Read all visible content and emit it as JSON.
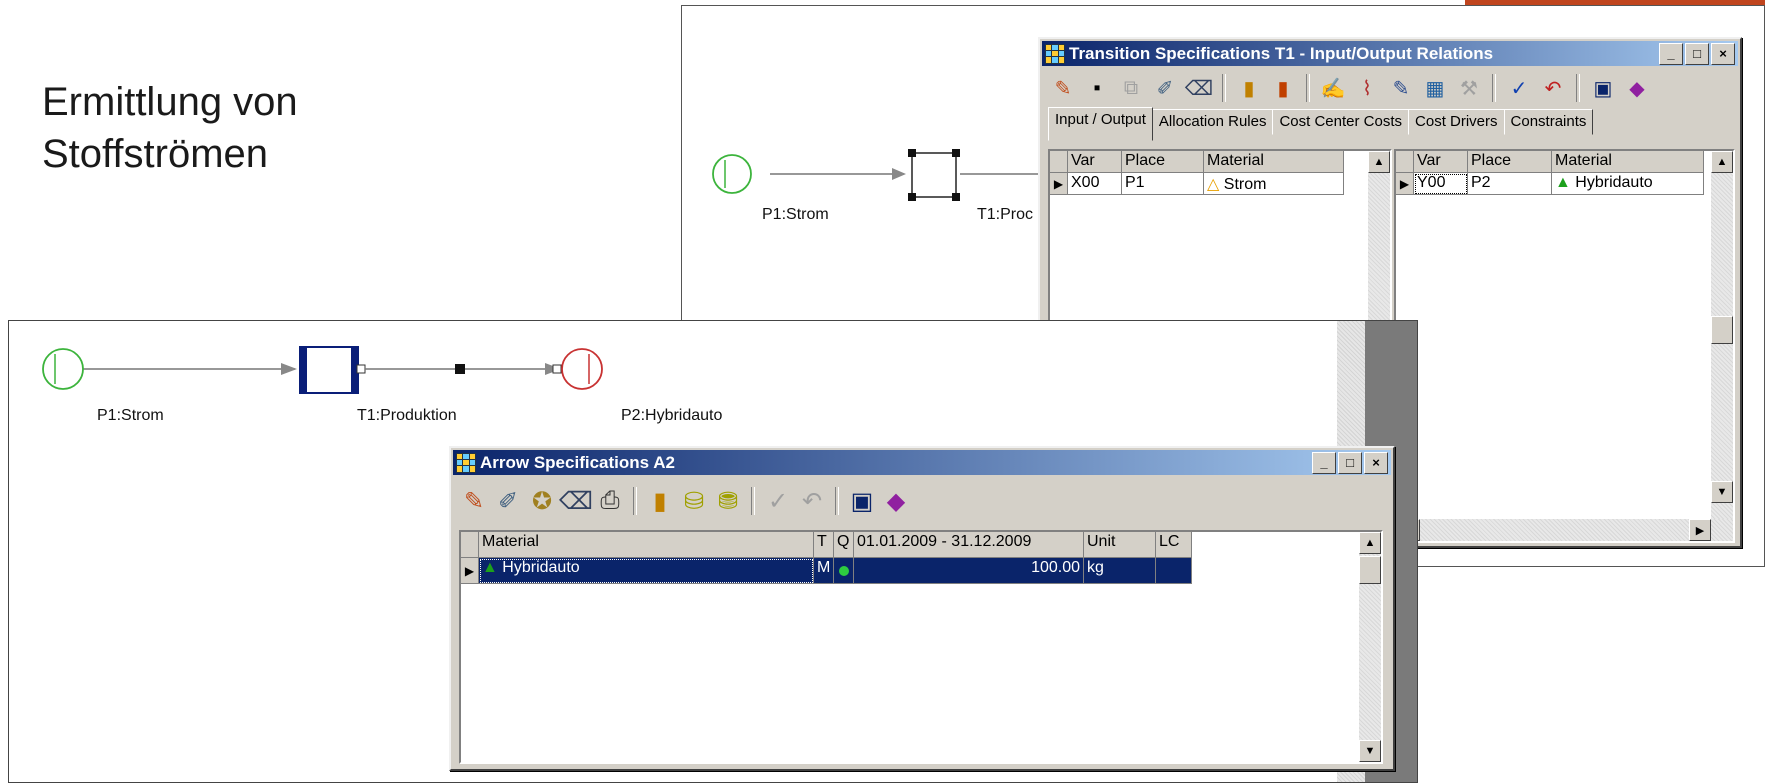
{
  "slide": {
    "title_line1": "Ermittlung von",
    "title_line2": "Stoffströmen"
  },
  "net_back": {
    "place1": "P1:Strom",
    "transition": "T1:Proc"
  },
  "net_front": {
    "place1": "P1:Strom",
    "transition": "T1:Produktion",
    "place2": "P2:Hybridauto"
  },
  "transition_dialog": {
    "title": "Transition Specifications T1 - Input/Output Relations",
    "tabs": [
      "Input / Output",
      "Allocation Rules",
      "Cost Center Costs",
      "Cost Drivers",
      "Constraints"
    ],
    "input_table": {
      "headers": [
        "Var",
        "Place",
        "Material"
      ],
      "rows": [
        {
          "var": "X00",
          "place": "P1",
          "material": "Strom"
        }
      ]
    },
    "output_table": {
      "headers": [
        "Var",
        "Place",
        "Material"
      ],
      "rows": [
        {
          "var": "Y00",
          "place": "P2",
          "material": "Hybridauto"
        }
      ]
    }
  },
  "arrow_dialog": {
    "title": "Arrow Specifications A2",
    "headers": [
      "Material",
      "T",
      "Q",
      "01.01.2009 - 31.12.2009",
      "Unit",
      "LC"
    ],
    "rows": [
      {
        "material": "Hybridauto",
        "t": "M",
        "q": "",
        "value": "100.00",
        "unit": "kg",
        "lc": ""
      }
    ]
  },
  "window_buttons": {
    "minimize": "_",
    "maximize": "□",
    "close": "×"
  },
  "colors": {
    "accent": "#c0451e",
    "titlebar": "#0a246a",
    "place_input": "#3cb43c",
    "place_output": "#c83232",
    "transition": "#0a1e78"
  },
  "icons": [
    "pen-icon",
    "add-icon",
    "delete-icon",
    "print-icon",
    "material-icon",
    "check-icon",
    "undo-icon",
    "save-icon",
    "help-icon"
  ]
}
